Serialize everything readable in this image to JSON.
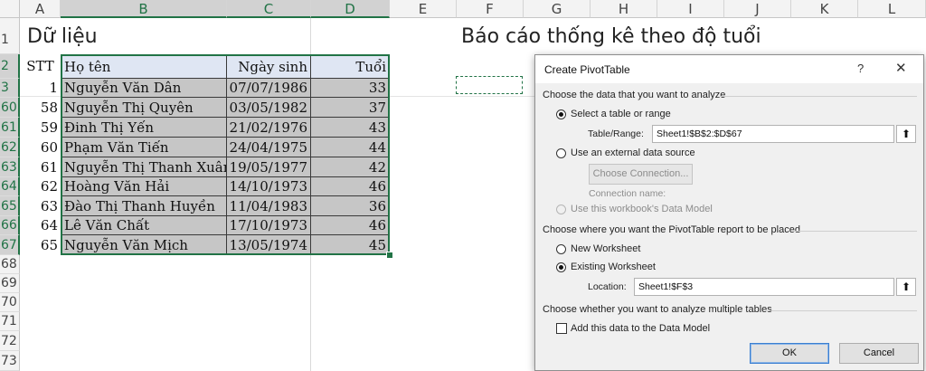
{
  "columns": [
    "A",
    "B",
    "C",
    "D",
    "E",
    "F",
    "G",
    "H",
    "I",
    "J",
    "K",
    "L"
  ],
  "rows": [
    "1",
    "2",
    "3",
    "60",
    "61",
    "62",
    "63",
    "64",
    "65",
    "66",
    "67",
    "68",
    "69",
    "70",
    "71",
    "72",
    "73"
  ],
  "sheet": {
    "title_left": "Dữ liệu",
    "title_right": "Báo cáo thống kê theo độ tuổi",
    "table": {
      "headers": {
        "stt": "STT",
        "name": "Họ tên",
        "dob": "Ngày sinh",
        "age": "Tuổi"
      },
      "records": [
        {
          "stt": "1",
          "name": "Nguyễn Văn Dân",
          "dob": "07/07/1986",
          "age": "33"
        },
        {
          "stt": "58",
          "name": "Nguyễn Thị Quyên",
          "dob": "03/05/1982",
          "age": "37"
        },
        {
          "stt": "59",
          "name": "Đinh Thị Yến",
          "dob": "21/02/1976",
          "age": "43"
        },
        {
          "stt": "60",
          "name": "Phạm Văn Tiến",
          "dob": "24/04/1975",
          "age": "44"
        },
        {
          "stt": "61",
          "name": "Nguyễn Thị Thanh Xuân",
          "dob": "19/05/1977",
          "age": "42"
        },
        {
          "stt": "62",
          "name": "Hoàng Văn Hải",
          "dob": "14/10/1973",
          "age": "46"
        },
        {
          "stt": "63",
          "name": "Đào Thị Thanh Huyền",
          "dob": "11/04/1983",
          "age": "36"
        },
        {
          "stt": "64",
          "name": "Lê Văn Chất",
          "dob": "17/10/1973",
          "age": "46"
        },
        {
          "stt": "65",
          "name": "Nguyễn Văn Mịch",
          "dob": "13/05/1974",
          "age": "45"
        }
      ]
    }
  },
  "dialog": {
    "title": "Create PivotTable",
    "help": "?",
    "close": "✕",
    "section1": "Choose the data that you want to analyze",
    "opt_select_table": "Select a table or range",
    "table_range_label": "Table/Range:",
    "table_range_value": "Sheet1!$B$2:$D$67",
    "opt_external": "Use an external data source",
    "choose_connection": "Choose Connection...",
    "connection_name": "Connection name:",
    "opt_data_model": "Use this workbook's Data Model",
    "section2": "Choose where you want the PivotTable report to be placed",
    "opt_new_ws": "New Worksheet",
    "opt_existing_ws": "Existing Worksheet",
    "location_label": "Location:",
    "location_value": "Sheet1!$F$3",
    "section3": "Choose whether you want to analyze multiple tables",
    "add_data_model": "Add this data to the Data Model",
    "ok": "OK",
    "cancel": "Cancel",
    "ref_icon": "collapse-arrow-icon"
  }
}
